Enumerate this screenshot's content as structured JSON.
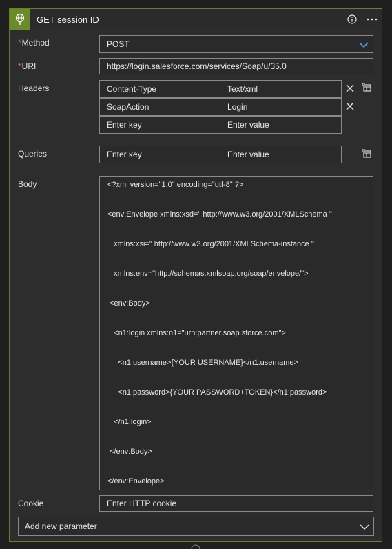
{
  "action": {
    "title": "GET session ID",
    "colors": {
      "accent": "#6b8a2a",
      "border": "#6e7a2c",
      "required": "#e26a6a"
    }
  },
  "icons": {
    "action": "globe-bulb-icon",
    "info": "info-icon",
    "more": "more-icon",
    "dropdown": "chevron-down-icon",
    "delete": "close-icon",
    "switch_mode": "table-icon"
  },
  "method": {
    "label": "Method",
    "required_mark": "*",
    "value": "POST"
  },
  "uri": {
    "label": "URI",
    "required_mark": "*",
    "value": "https://login.salesforce.com/services/Soap/u/35.0"
  },
  "headers": {
    "label": "Headers",
    "rows": [
      {
        "key": "Content-Type",
        "value": "Text/xml"
      },
      {
        "key": "SoapAction",
        "value": "Login"
      }
    ],
    "key_placeholder": "Enter key",
    "value_placeholder": "Enter value"
  },
  "queries": {
    "label": "Queries",
    "key_placeholder": "Enter key",
    "value_placeholder": "Enter value"
  },
  "body": {
    "label": "Body",
    "lines": [
      "<?xml version=\"1.0\" encoding=\"utf-8\" ?>",
      "<env:Envelope xmlns:xsd=\" http://www.w3.org/2001/XMLSchema \"",
      "   xmlns:xsi=\" http://www.w3.org/2001/XMLSchema-instance \"",
      "   xmlns:env=\"http://schemas.xmlsoap.org/soap/envelope/\">",
      " <env:Body>",
      "   <n1:login xmlns:n1=\"urn:partner.soap.sforce.com\">",
      "     <n1:username>{YOUR USERNAME}</n1:username>",
      "     <n1:password>{YOUR PASSWORD+TOKEN}</n1:password>",
      "   </n1:login>",
      " </env:Body>",
      "</env:Envelope>"
    ]
  },
  "cookie": {
    "label": "Cookie",
    "placeholder": "Enter HTTP cookie"
  },
  "add_parameter": {
    "label": "Add new parameter"
  }
}
